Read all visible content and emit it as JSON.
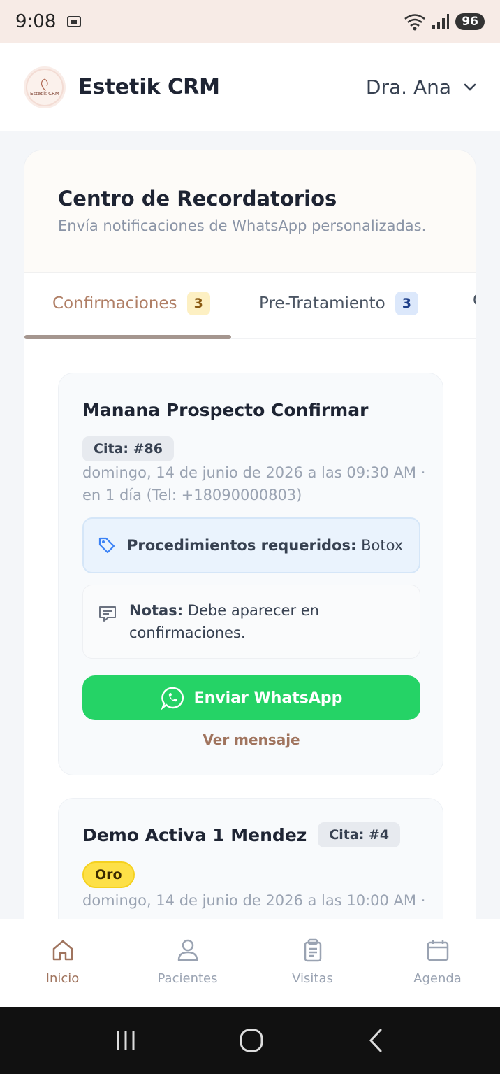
{
  "status_bar": {
    "time": "9:08",
    "battery": "96"
  },
  "header": {
    "logo_text": "Estetik CRM",
    "app_title": "Estetik CRM",
    "user_name": "Dra. Ana"
  },
  "reminders": {
    "title": "Centro de Recordatorios",
    "subtitle": "Envía notificaciones de WhatsApp personalizadas.",
    "tabs": [
      {
        "label": "Confirmaciones",
        "count": "3"
      },
      {
        "label": "Pre-Tratamiento",
        "count": "3"
      },
      {
        "label": "C",
        "count": ""
      }
    ],
    "items": [
      {
        "name": "Manana Prospecto Confirmar",
        "cita": "Cita: #86",
        "date_line1": "domingo, 14 de junio de 2026 a las 09:30 AM ·",
        "date_line2": "en 1 día (Tel: +18090000803)",
        "procedures_label": "Procedimientos requeridos:",
        "procedures_value": "Botox",
        "notes_label": "Notas:",
        "notes_value": "Debe aparecer en confirmaciones.",
        "send_button": "Enviar WhatsApp",
        "view_message": "Ver mensaje"
      },
      {
        "name": "Demo Activa 1 Mendez",
        "cita": "Cita: #4",
        "level": "Oro",
        "date_line1": "domingo, 14 de junio de 2026 a las 10:00 AM ·"
      }
    ]
  },
  "bottom_nav": {
    "items": [
      {
        "label": "Inicio",
        "icon": "home-icon",
        "active": true
      },
      {
        "label": "Pacientes",
        "icon": "user-icon",
        "active": false
      },
      {
        "label": "Visitas",
        "icon": "clipboard-icon",
        "active": false
      },
      {
        "label": "Agenda",
        "icon": "calendar-icon",
        "active": false
      }
    ]
  },
  "colors": {
    "accent": "#a0745e",
    "whatsapp": "#25d366",
    "gold_badge": "#fde047"
  }
}
